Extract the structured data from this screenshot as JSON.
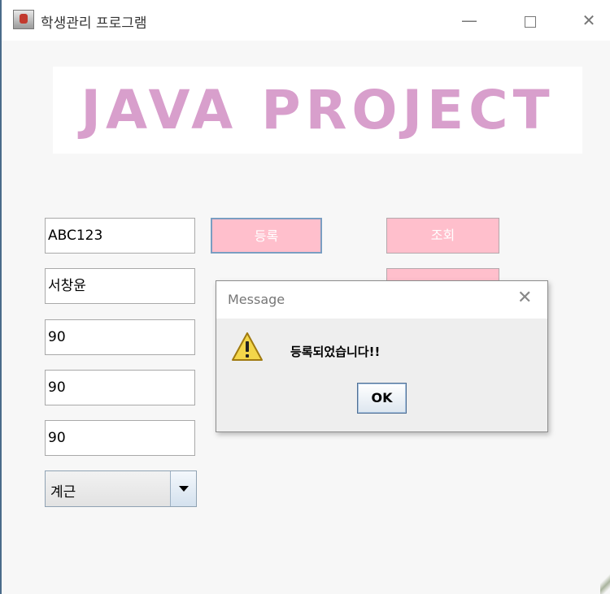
{
  "window": {
    "title": "학생관리 프로그램",
    "minimize_glyph": "—",
    "close_glyph": "✕"
  },
  "banner": {
    "text": "JAVA PROJECT",
    "color": "#d89fcc"
  },
  "form": {
    "fields": [
      "ABC123",
      "서창윤",
      "90",
      "90",
      "90"
    ],
    "register_button": "등록",
    "search_button": "조회",
    "department_select": "계근"
  },
  "dialog": {
    "title": "Message",
    "close_glyph": "✕",
    "icon": "warning-icon",
    "message": "등록되었습니다!!",
    "ok_label": "OK"
  },
  "colors": {
    "button_pink": "#ffbfcc",
    "banner_pink": "#d89fcc"
  }
}
